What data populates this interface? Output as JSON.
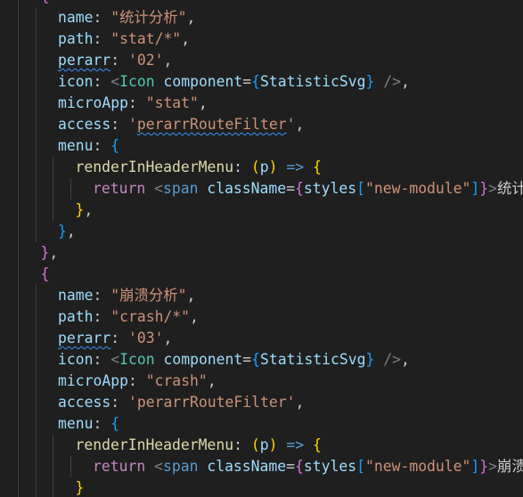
{
  "editor": {
    "colors": {
      "background": "#1f1f1f",
      "indent_guide": "#3f3f3f",
      "property": "#9cdcfe",
      "string": "#ce9178",
      "bracket_level1": "#ffd700",
      "bracket_level2": "#da70d6",
      "bracket_level3": "#179fff",
      "jsx_component": "#4ec9b0",
      "keyword_return": "#c586c0",
      "arrow": "#569cd6",
      "function": "#dcdcaa",
      "spell_check_squiggle": "#3794ff"
    },
    "lines": [
      {
        "indent": 1,
        "tokens": [
          {
            "t": "{",
            "c": "b2"
          }
        ]
      },
      {
        "indent": 2,
        "tokens": [
          {
            "t": "name",
            "c": "key"
          },
          {
            "t": ": ",
            "c": "punc"
          },
          {
            "t": "\"统计分析\"",
            "c": "str"
          },
          {
            "t": ",",
            "c": "punc"
          }
        ]
      },
      {
        "indent": 2,
        "tokens": [
          {
            "t": "path",
            "c": "key"
          },
          {
            "t": ": ",
            "c": "punc"
          },
          {
            "t": "\"stat/*\"",
            "c": "str"
          },
          {
            "t": ",",
            "c": "punc"
          }
        ]
      },
      {
        "indent": 2,
        "tokens": [
          {
            "t": "perarr",
            "c": "key",
            "sq": true
          },
          {
            "t": ": ",
            "c": "punc"
          },
          {
            "t": "'02'",
            "c": "str"
          },
          {
            "t": ",",
            "c": "punc"
          }
        ]
      },
      {
        "indent": 2,
        "tokens": [
          {
            "t": "icon",
            "c": "key"
          },
          {
            "t": ": ",
            "c": "punc"
          },
          {
            "t": "<",
            "c": "tag"
          },
          {
            "t": "Icon",
            "c": "comp"
          },
          {
            "t": " ",
            "c": "punc"
          },
          {
            "t": "component",
            "c": "attr"
          },
          {
            "t": "=",
            "c": "punc"
          },
          {
            "t": "{",
            "c": "b3"
          },
          {
            "t": "StatisticSvg",
            "c": "key"
          },
          {
            "t": "}",
            "c": "b3"
          },
          {
            "t": " />",
            "c": "tag"
          },
          {
            "t": ",",
            "c": "punc"
          }
        ]
      },
      {
        "indent": 2,
        "tokens": [
          {
            "t": "microApp",
            "c": "key"
          },
          {
            "t": ": ",
            "c": "punc"
          },
          {
            "t": "\"stat\"",
            "c": "str"
          },
          {
            "t": ",",
            "c": "punc"
          }
        ]
      },
      {
        "indent": 2,
        "tokens": [
          {
            "t": "access",
            "c": "key"
          },
          {
            "t": ": ",
            "c": "punc"
          },
          {
            "t": "'",
            "c": "str"
          },
          {
            "t": "perarrRouteFilter",
            "c": "str",
            "sq": true
          },
          {
            "t": "'",
            "c": "str"
          },
          {
            "t": ",",
            "c": "punc"
          }
        ]
      },
      {
        "indent": 2,
        "tokens": [
          {
            "t": "menu",
            "c": "key"
          },
          {
            "t": ": ",
            "c": "punc"
          },
          {
            "t": "{",
            "c": "b3"
          }
        ]
      },
      {
        "indent": 3,
        "tokens": [
          {
            "t": "renderInHeaderMenu",
            "c": "fn"
          },
          {
            "t": ": ",
            "c": "punc"
          },
          {
            "t": "(",
            "c": "b1"
          },
          {
            "t": "p",
            "c": "param"
          },
          {
            "t": ")",
            "c": "b1"
          },
          {
            "t": " ",
            "c": "punc"
          },
          {
            "t": "=>",
            "c": "arrow"
          },
          {
            "t": " ",
            "c": "punc"
          },
          {
            "t": "{",
            "c": "b1"
          }
        ]
      },
      {
        "indent": 4,
        "tokens": [
          {
            "t": "return",
            "c": "kw"
          },
          {
            "t": " ",
            "c": "punc"
          },
          {
            "t": "<",
            "c": "tag"
          },
          {
            "t": "span",
            "c": "kw2"
          },
          {
            "t": " ",
            "c": "punc"
          },
          {
            "t": "className",
            "c": "attr"
          },
          {
            "t": "=",
            "c": "punc"
          },
          {
            "t": "{",
            "c": "b2"
          },
          {
            "t": "styles",
            "c": "key"
          },
          {
            "t": "[",
            "c": "b3"
          },
          {
            "t": "\"new-module\"",
            "c": "str"
          },
          {
            "t": "]",
            "c": "b3"
          },
          {
            "t": "}",
            "c": "b2"
          },
          {
            "t": ">",
            "c": "tag"
          },
          {
            "t": "统计",
            "c": "text"
          }
        ]
      },
      {
        "indent": 3,
        "tokens": [
          {
            "t": "}",
            "c": "b1"
          },
          {
            "t": ",",
            "c": "punc"
          }
        ]
      },
      {
        "indent": 2,
        "tokens": [
          {
            "t": "}",
            "c": "b3"
          },
          {
            "t": ",",
            "c": "punc"
          }
        ]
      },
      {
        "indent": 1,
        "tokens": [
          {
            "t": "}",
            "c": "b2"
          },
          {
            "t": ",",
            "c": "punc"
          }
        ]
      },
      {
        "indent": 1,
        "tokens": [
          {
            "t": "{",
            "c": "b2"
          }
        ]
      },
      {
        "indent": 2,
        "tokens": [
          {
            "t": "name",
            "c": "key"
          },
          {
            "t": ": ",
            "c": "punc"
          },
          {
            "t": "\"崩溃分析\"",
            "c": "str"
          },
          {
            "t": ",",
            "c": "punc"
          }
        ]
      },
      {
        "indent": 2,
        "tokens": [
          {
            "t": "path",
            "c": "key"
          },
          {
            "t": ": ",
            "c": "punc"
          },
          {
            "t": "\"crash/*\"",
            "c": "str"
          },
          {
            "t": ",",
            "c": "punc"
          }
        ]
      },
      {
        "indent": 2,
        "tokens": [
          {
            "t": "perarr",
            "c": "key",
            "sq": true
          },
          {
            "t": ": ",
            "c": "punc"
          },
          {
            "t": "'03'",
            "c": "str"
          },
          {
            "t": ",",
            "c": "punc"
          }
        ]
      },
      {
        "indent": 2,
        "tokens": [
          {
            "t": "icon",
            "c": "key"
          },
          {
            "t": ": ",
            "c": "punc"
          },
          {
            "t": "<",
            "c": "tag"
          },
          {
            "t": "Icon",
            "c": "comp"
          },
          {
            "t": " ",
            "c": "punc"
          },
          {
            "t": "component",
            "c": "attr"
          },
          {
            "t": "=",
            "c": "punc"
          },
          {
            "t": "{",
            "c": "b3"
          },
          {
            "t": "StatisticSvg",
            "c": "key"
          },
          {
            "t": "}",
            "c": "b3"
          },
          {
            "t": " />",
            "c": "tag"
          },
          {
            "t": ",",
            "c": "punc"
          }
        ]
      },
      {
        "indent": 2,
        "tokens": [
          {
            "t": "microApp",
            "c": "key"
          },
          {
            "t": ": ",
            "c": "punc"
          },
          {
            "t": "\"crash\"",
            "c": "str"
          },
          {
            "t": ",",
            "c": "punc"
          }
        ]
      },
      {
        "indent": 2,
        "tokens": [
          {
            "t": "access",
            "c": "key"
          },
          {
            "t": ": ",
            "c": "punc"
          },
          {
            "t": "'perarrRouteFilter'",
            "c": "str"
          },
          {
            "t": ",",
            "c": "punc"
          }
        ]
      },
      {
        "indent": 2,
        "tokens": [
          {
            "t": "menu",
            "c": "key"
          },
          {
            "t": ": ",
            "c": "punc"
          },
          {
            "t": "{",
            "c": "b3"
          }
        ]
      },
      {
        "indent": 3,
        "tokens": [
          {
            "t": "renderInHeaderMenu",
            "c": "fn"
          },
          {
            "t": ": ",
            "c": "punc"
          },
          {
            "t": "(",
            "c": "b1"
          },
          {
            "t": "p",
            "c": "param"
          },
          {
            "t": ")",
            "c": "b1"
          },
          {
            "t": " ",
            "c": "punc"
          },
          {
            "t": "=>",
            "c": "arrow"
          },
          {
            "t": " ",
            "c": "punc"
          },
          {
            "t": "{",
            "c": "b1"
          }
        ]
      },
      {
        "indent": 4,
        "tokens": [
          {
            "t": "return",
            "c": "kw"
          },
          {
            "t": " ",
            "c": "punc"
          },
          {
            "t": "<",
            "c": "tag"
          },
          {
            "t": "span",
            "c": "kw2"
          },
          {
            "t": " ",
            "c": "punc"
          },
          {
            "t": "className",
            "c": "attr"
          },
          {
            "t": "=",
            "c": "punc"
          },
          {
            "t": "{",
            "c": "b2"
          },
          {
            "t": "styles",
            "c": "key"
          },
          {
            "t": "[",
            "c": "b3"
          },
          {
            "t": "\"new-module\"",
            "c": "str"
          },
          {
            "t": "]",
            "c": "b3"
          },
          {
            "t": "}",
            "c": "b2"
          },
          {
            "t": ">",
            "c": "tag"
          },
          {
            "t": "崩溃",
            "c": "text"
          }
        ]
      },
      {
        "indent": 3,
        "tokens": [
          {
            "t": "}",
            "c": "b1"
          }
        ]
      }
    ]
  }
}
